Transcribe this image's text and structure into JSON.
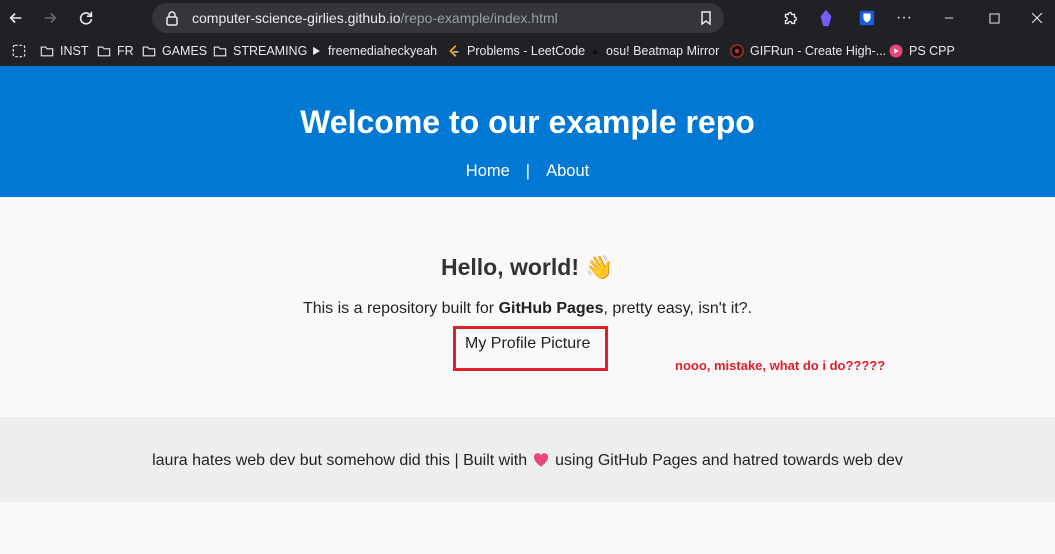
{
  "browser": {
    "url_domain": "computer-science-girlies.github.io",
    "url_path": "/repo-example/index.html",
    "bookmarks": [
      "INST",
      "FR",
      "GAMES",
      "STREAMING",
      "freemediaheckyeah",
      "Problems - LeetCode",
      "osu! Beatmap Mirror",
      "GIFRun - Create High-...",
      "PS CPP"
    ]
  },
  "header": {
    "title": "Welcome to our example repo",
    "nav": {
      "home": "Home",
      "separator": "|",
      "about": "About"
    }
  },
  "main": {
    "heading": "Hello, world!",
    "wave": "👋",
    "intro_before": "This is a repository built for ",
    "intro_bold": "GitHub Pages",
    "intro_after": ", pretty easy, isn't it?.",
    "profile_text": "My Profile Picture",
    "annotation": "nooo, mistake, what do i do?????"
  },
  "footer": {
    "text_before": "laura hates web dev but somehow did this | Built with",
    "text_after": "using GitHub Pages and hatred towards web dev"
  },
  "colors": {
    "header_bg": "#0078d4",
    "annotation_red": "#e11d2a",
    "heart": "#e8457a"
  }
}
